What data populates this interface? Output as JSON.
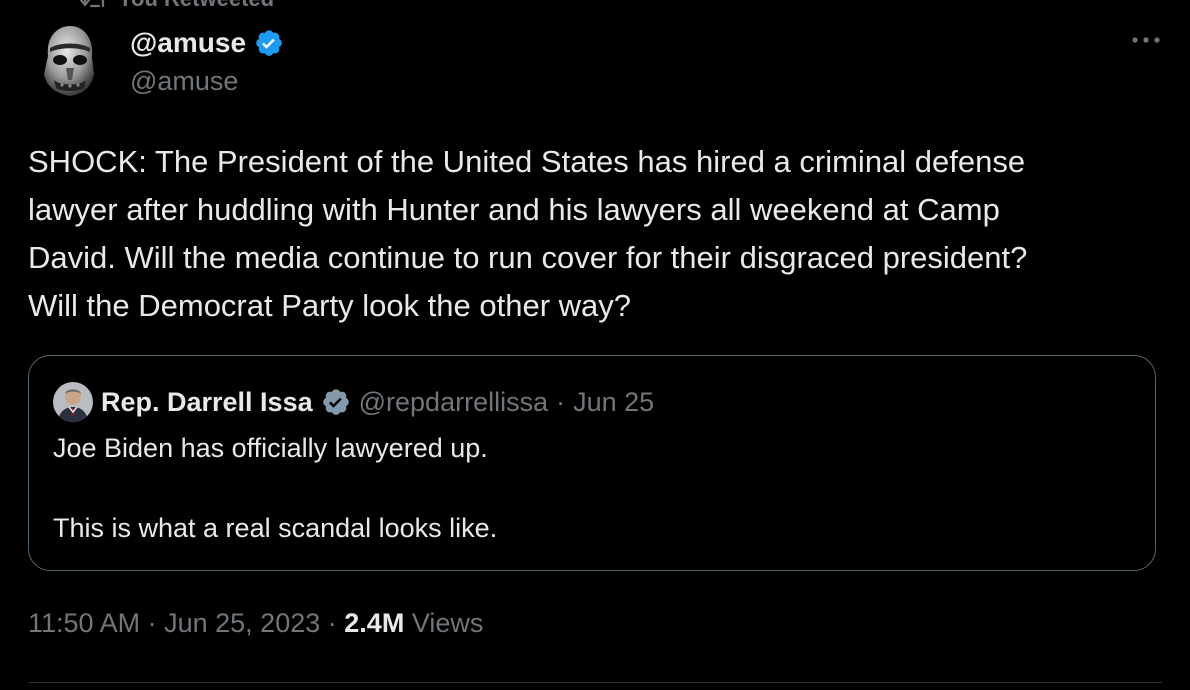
{
  "retweet": {
    "icon": "retweet-icon",
    "label": "You Retweeted"
  },
  "author": {
    "display_name": "@amuse",
    "handle": "@amuse",
    "verified_icon": "verified-badge-icon",
    "verified_color": "#1d9bf0",
    "avatar_icon": "stormtrooper-avatar"
  },
  "more_icon": "more-options-icon",
  "tweet": {
    "text_lines": [
      "SHOCK: The President of the United States has hired a criminal defense",
      "lawyer after huddling with Hunter and his lawyers all weekend at Camp",
      "David. Will the media continue to run cover for their disgraced president?",
      "Will the Democrat Party look the other way?"
    ]
  },
  "quote": {
    "name": "Rep. Darrell Issa",
    "badge_icon": "government-badge-icon",
    "badge_color": "#829aab",
    "handle": "@repdarrellissa",
    "separator": "·",
    "date": "Jun 25",
    "lines": [
      "Joe Biden has officially lawyered up.",
      "",
      "This is what a real scandal looks like."
    ]
  },
  "meta": {
    "time": "11:50 AM",
    "sep1": "·",
    "date": "Jun 25, 2023",
    "sep2": "·",
    "views_count": "2.4M",
    "views_label": "Views"
  },
  "colors": {
    "background": "#000000",
    "text_primary": "#e7e9ea",
    "text_secondary": "#71767b",
    "border": "#536471",
    "divider": "#2f3336"
  }
}
